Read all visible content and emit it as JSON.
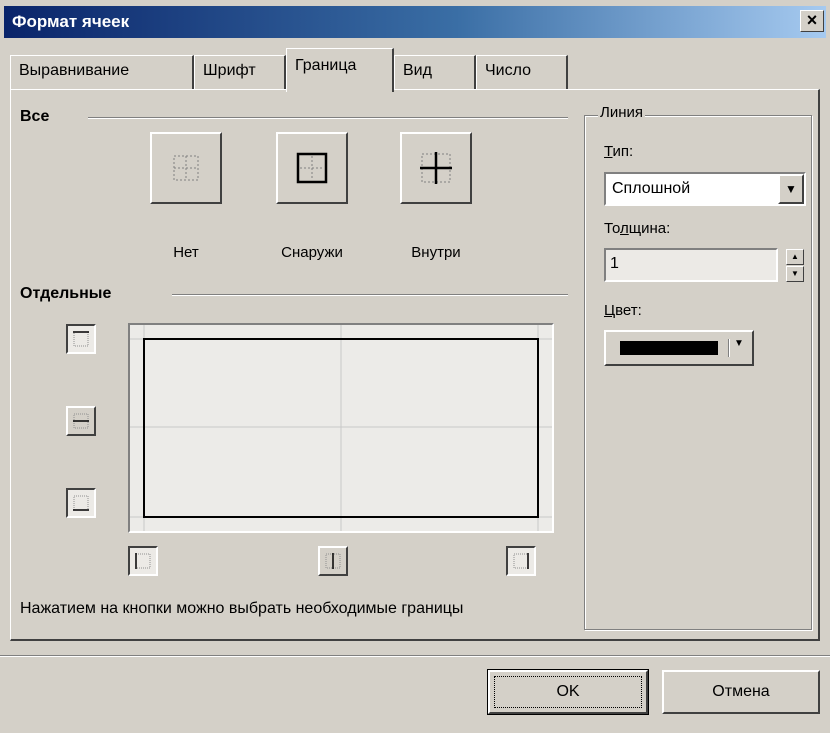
{
  "window": {
    "title": "Формат ячеек",
    "close_glyph": "×"
  },
  "tabs": [
    {
      "label": "Выравнивание",
      "active": false
    },
    {
      "label": "Шрифт",
      "active": false
    },
    {
      "label": "Граница",
      "active": true
    },
    {
      "label": "Вид",
      "active": false
    },
    {
      "label": "Число",
      "active": false
    }
  ],
  "presets": {
    "section_label": "Все",
    "items": [
      {
        "label": "Нет",
        "icon": "border-none-icon"
      },
      {
        "label": "Снаружи",
        "icon": "border-outline-icon"
      },
      {
        "label": "Внутри",
        "icon": "border-inside-icon"
      }
    ]
  },
  "individual": {
    "section_label": "Отдельные",
    "buttons": [
      {
        "icon": "border-top-icon",
        "pressed": true
      },
      {
        "icon": "border-middle-horizontal-icon",
        "pressed": false
      },
      {
        "icon": "border-bottom-icon",
        "pressed": true
      },
      {
        "icon": "border-left-icon",
        "pressed": true
      },
      {
        "icon": "border-middle-vertical-icon",
        "pressed": false
      },
      {
        "icon": "border-right-icon",
        "pressed": true
      }
    ]
  },
  "line": {
    "group_label": "Линия",
    "type_label_first": "Т",
    "type_label_rest": "ип:",
    "type_value": "Сплошной",
    "thickness_label_a": "То",
    "thickness_label_u": "л",
    "thickness_label_b": "щина:",
    "thickness_value": "1",
    "color_label_first": "Ц",
    "color_label_rest": "вет:",
    "color_value": "#000000"
  },
  "hint": "Нажатием на кнопки можно выбрать необходимые границы",
  "buttons": {
    "ok": "OK",
    "cancel": "Отмена"
  }
}
